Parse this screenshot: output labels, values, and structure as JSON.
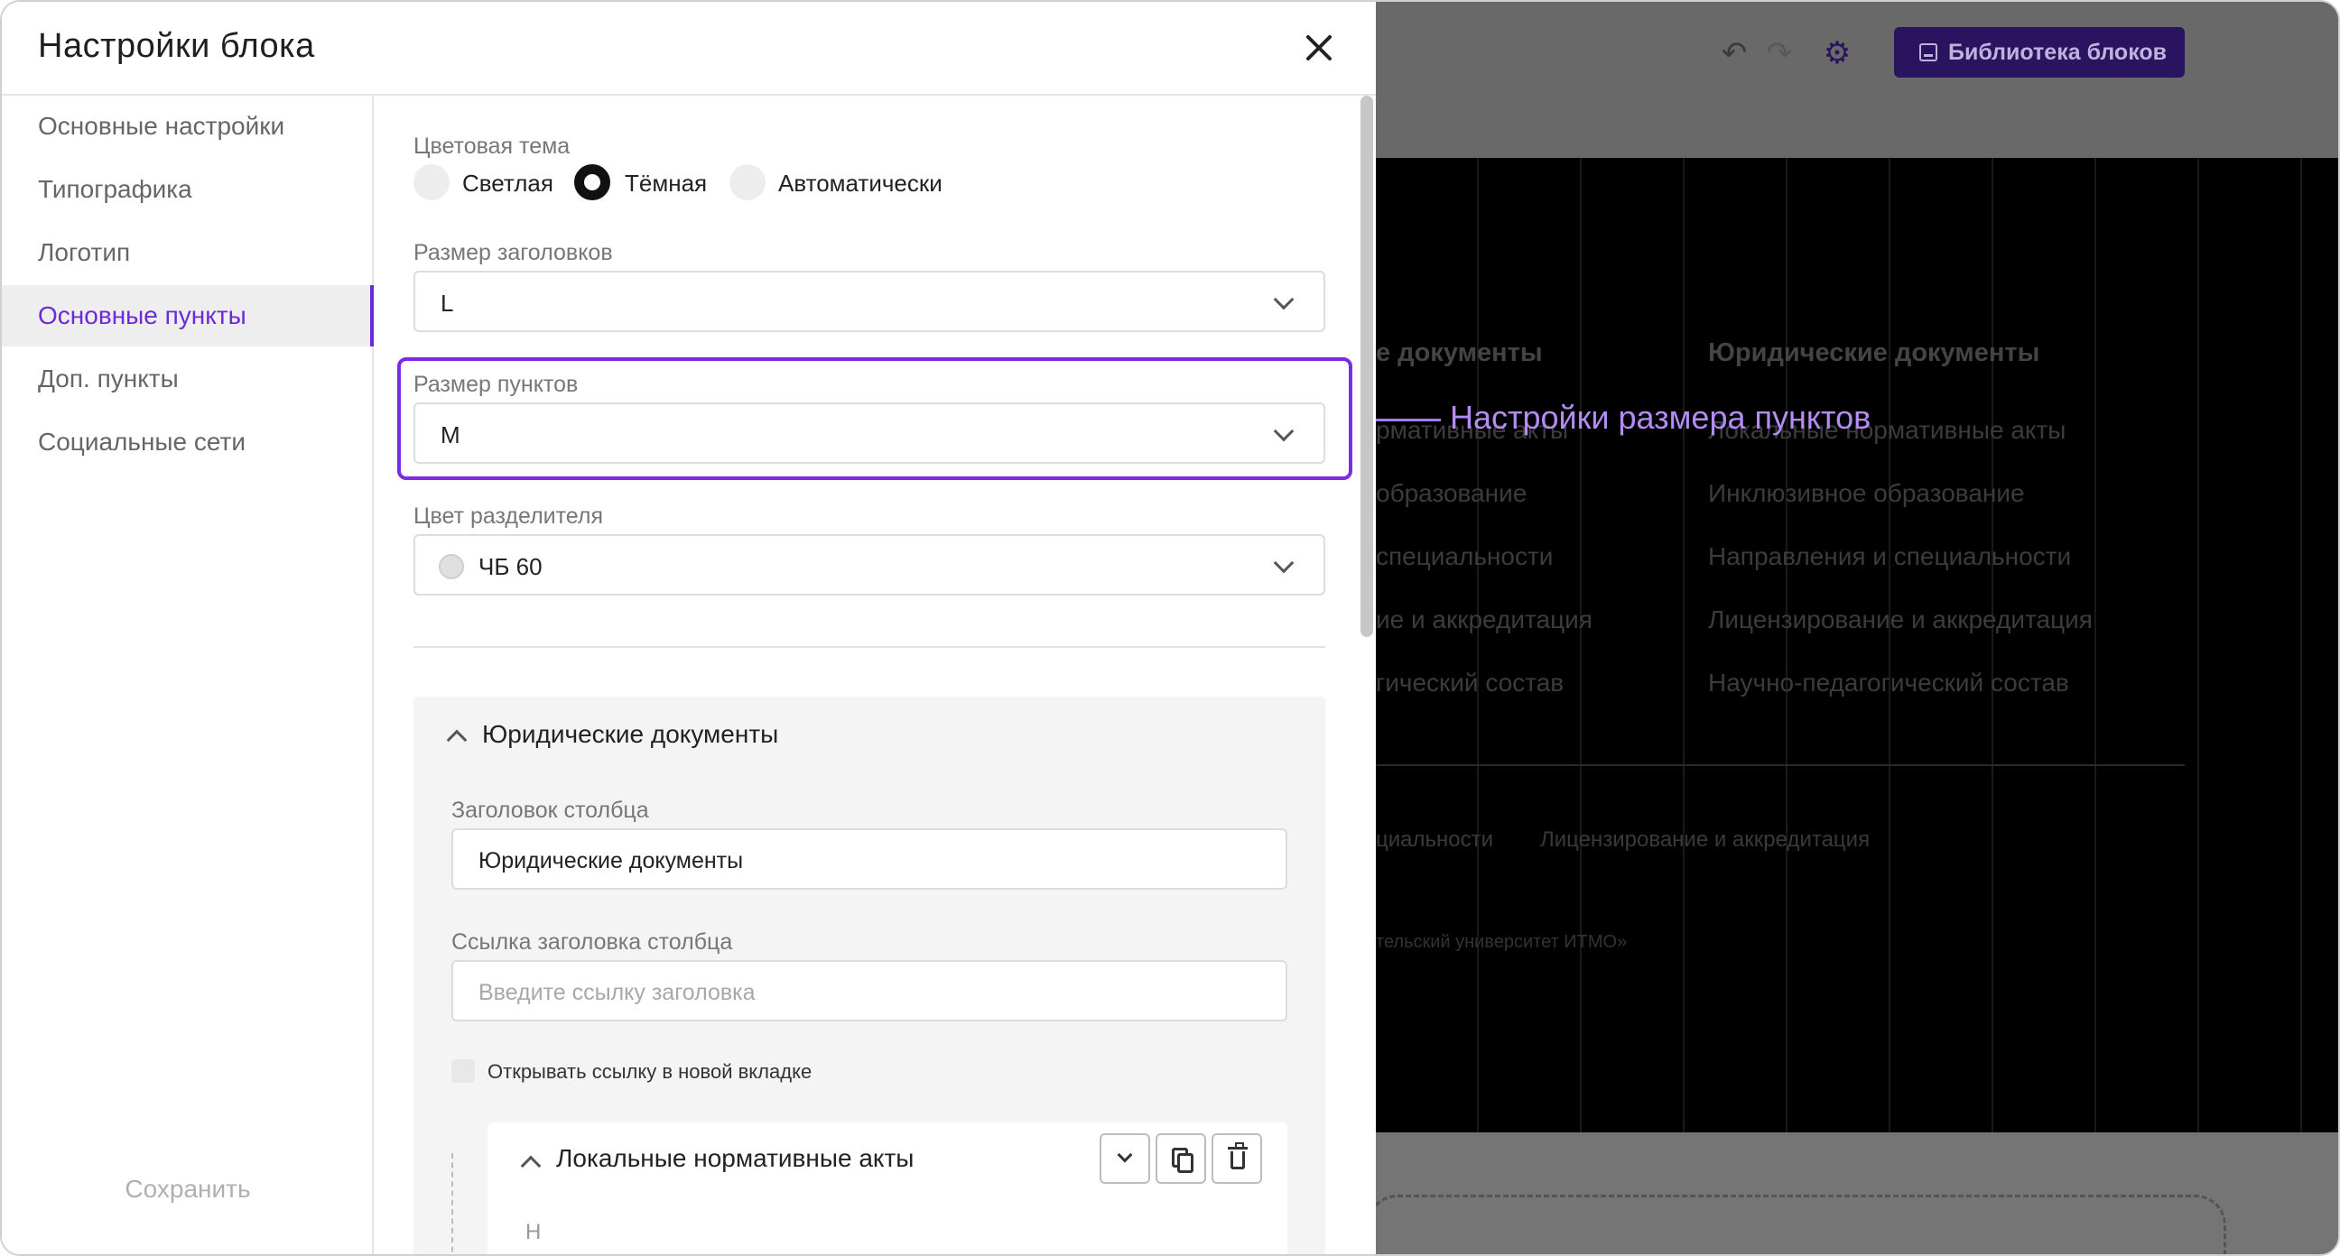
{
  "modal": {
    "title": "Настройки блока",
    "close_label": "×"
  },
  "sidebar": {
    "items": [
      {
        "label": "Основные настройки"
      },
      {
        "label": "Типографика"
      },
      {
        "label": "Логотип"
      },
      {
        "label": "Основные пункты",
        "active": true
      },
      {
        "label": "Доп. пункты"
      },
      {
        "label": "Социальные сети"
      }
    ],
    "save_label": "Сохранить"
  },
  "settings": {
    "color_theme": {
      "label": "Цветовая тема",
      "options": [
        "Светлая",
        "Тёмная",
        "Автоматически"
      ],
      "selected": "Тёмная"
    },
    "heading_size": {
      "label": "Размер заголовков",
      "value": "L"
    },
    "item_size": {
      "label": "Размер пунктов",
      "value": "M"
    },
    "divider_color": {
      "label": "Цвет разделителя",
      "value": "ЧБ 60"
    }
  },
  "column_group": {
    "title": "Юридические документы",
    "column_title_label": "Заголовок столбца",
    "column_title_value": "Юридические документы",
    "column_link_label": "Ссылка заголовка столбца",
    "column_link_placeholder": "Введите ссылку заголовка",
    "new_tab_label": "Открывать ссылку в новой вкладке",
    "sub_item_title": "Локальные нормативные акты",
    "cut_text": "Н"
  },
  "callout": {
    "text": "Настройки размера пунктов",
    "color": "#a879f0"
  },
  "background": {
    "library_button": "Библиотека блоков",
    "col1_heading": "е документы",
    "col1_items": [
      "рмативные акты",
      "образование",
      "специальности",
      "ие и аккредитация",
      "гический состав"
    ],
    "col2_heading": "Юридические документы",
    "col2_items": [
      "Локальные нормативные акты",
      "Инклюзивное образование",
      "Направления и специальности",
      "Лицензирование и аккредитация",
      "Научно-педагогический состав"
    ],
    "footer_links": [
      "циальности",
      "Лицензирование и аккредитация"
    ],
    "copyright": "тельский университет ИТМО»"
  },
  "colors": {
    "accent": "#6c2bd9",
    "highlight": "#7a2be6",
    "library_button_bg": "#2a1460"
  }
}
